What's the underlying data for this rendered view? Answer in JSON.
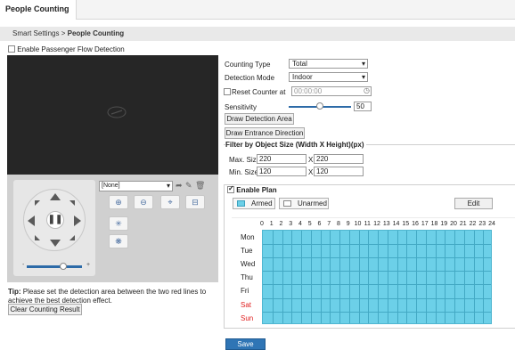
{
  "tab": {
    "title": "People Counting"
  },
  "breadcrumb": {
    "parent": "Smart Settings",
    "separator": ">",
    "current": "People Counting"
  },
  "enable_flow": {
    "label": "Enable Passenger Flow Detection",
    "checked": false
  },
  "preview": {
    "preset": "[None]",
    "zoom_in": "+",
    "zoom_out": "−",
    "slider_min": "-",
    "slider_max": "+",
    "slider_value": 0.65
  },
  "tip": {
    "prefix": "Tip:",
    "text": "Please set the detection area between the two red lines to achieve the best detection effect."
  },
  "clear_button": "Clear Counting Result",
  "settings": {
    "counting_type_label": "Counting Type",
    "counting_type_value": "Total",
    "detection_mode_label": "Detection Mode",
    "detection_mode_value": "Indoor",
    "reset_label": "Reset Counter at",
    "reset_value": "00:00:00",
    "reset_checked": false,
    "sensitivity_label": "Sensitivity",
    "sensitivity_value": "50",
    "draw_area_button": "Draw Detection Area",
    "draw_direction_button": "Draw Entrance Direction"
  },
  "filter": {
    "title": "Filter by Object Size (Width X Height)(px)",
    "max_label": "Max. Size",
    "max_w": "220",
    "max_h": "220",
    "min_label": "Min. Size",
    "min_w": "120",
    "min_h": "120",
    "x": "X"
  },
  "plan": {
    "title": "Enable Plan",
    "checked": true,
    "armed": "Armed",
    "unarmed": "Unarmed",
    "edit": "Edit",
    "hours": [
      "0",
      "1",
      "2",
      "3",
      "4",
      "5",
      "6",
      "7",
      "8",
      "9",
      "10",
      "11",
      "12",
      "13",
      "14",
      "15",
      "16",
      "17",
      "18",
      "19",
      "20",
      "21",
      "22",
      "23",
      "24"
    ],
    "days": [
      "Mon",
      "Tue",
      "Wed",
      "Thu",
      "Fri",
      "Sat",
      "Sun"
    ],
    "armed_color": "#6cd0e8",
    "weekend_color": "#e02020"
  },
  "save_button": "Save"
}
